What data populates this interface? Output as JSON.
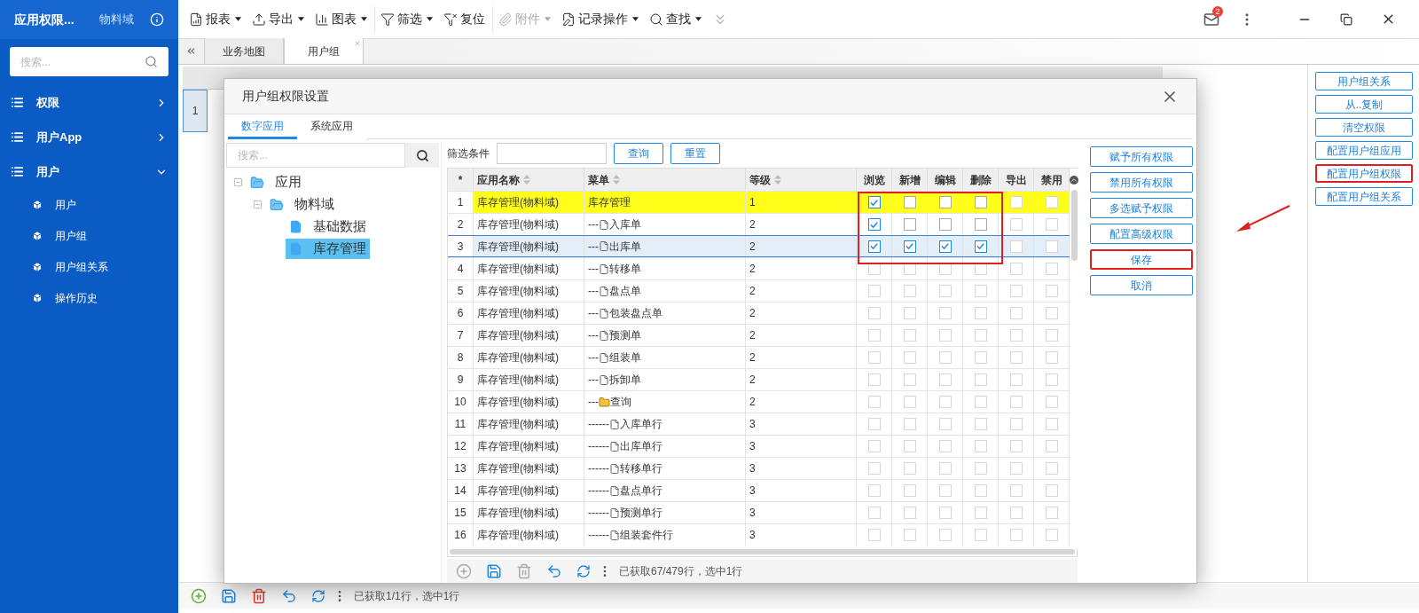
{
  "sidebar": {
    "title": "应用权限...",
    "domain": "物料域",
    "search": {
      "placeholder": "搜索..."
    },
    "items": [
      {
        "label": "权限",
        "expanded": false
      },
      {
        "label": "用户App",
        "expanded": false
      },
      {
        "label": "用户",
        "expanded": true,
        "children": [
          {
            "label": "用户"
          },
          {
            "label": "用户组"
          },
          {
            "label": "用户组关系"
          },
          {
            "label": "操作历史"
          }
        ]
      }
    ]
  },
  "toolbar": [
    {
      "kind": "report",
      "label": "报表",
      "dropdown": true,
      "disabled": false
    },
    {
      "kind": "export",
      "label": "导出",
      "dropdown": true,
      "disabled": false
    },
    {
      "kind": "chart",
      "label": "图表",
      "dropdown": true,
      "disabled": false
    },
    {
      "kind": "filter",
      "label": "筛选",
      "dropdown": true,
      "disabled": false
    },
    {
      "kind": "reset",
      "label": "复位",
      "dropdown": false,
      "disabled": false
    },
    {
      "kind": "attach",
      "label": "附件",
      "dropdown": true,
      "disabled": true
    },
    {
      "kind": "record",
      "label": "记录操作",
      "dropdown": true,
      "disabled": false
    },
    {
      "kind": "find",
      "label": "查找",
      "dropdown": true,
      "disabled": false
    }
  ],
  "mail_badge": "2",
  "tabs": [
    {
      "label": "业务地图",
      "selected": false
    },
    {
      "label": "用户组",
      "selected": true
    }
  ],
  "bg_table": {
    "row_number": "1"
  },
  "bg_status": "已获取1/1行，选中1行",
  "side_buttons": [
    {
      "label": "用户组关系",
      "marked": false
    },
    {
      "label": "从..复制",
      "marked": false
    },
    {
      "label": "清空权限",
      "marked": false
    },
    {
      "label": "配置用户组应用",
      "marked": false
    },
    {
      "label": "配置用户组权限",
      "marked": true
    },
    {
      "label": "配置用户组关系",
      "marked": false
    }
  ],
  "dialog": {
    "title": "用户组权限设置",
    "tabs": [
      {
        "label": "数字应用",
        "selected": true
      },
      {
        "label": "系统应用",
        "selected": false
      }
    ],
    "tree_search": {
      "placeholder": "搜索..."
    },
    "tree": [
      {
        "label": "应用",
        "expanded": true,
        "selected": false,
        "children": [
          {
            "label": "物料域",
            "expanded": true,
            "selected": false,
            "children": [
              {
                "label": "基础数据",
                "selected": false
              },
              {
                "label": "库存管理",
                "selected": true
              }
            ]
          }
        ]
      }
    ],
    "filter_label": "筛选条件",
    "query_button": "查询",
    "reset_button": "重置",
    "columns": [
      "*",
      "应用名称",
      "菜单",
      "等级",
      "浏览",
      "新增",
      "编辑",
      "删除",
      "导出",
      "禁用"
    ],
    "rows": [
      {
        "no": "1",
        "app": "库存管理(物料域)",
        "prefix": "",
        "kind": "root",
        "menu": "库存管理",
        "level": "1",
        "highlighted": true,
        "selected": false,
        "perms": [
          true,
          false,
          false,
          false,
          false,
          false
        ]
      },
      {
        "no": "2",
        "app": "库存管理(物料域)",
        "prefix": "---",
        "kind": "item",
        "menu": "入库单",
        "level": "2",
        "highlighted": false,
        "selected": false,
        "perms": [
          true,
          false,
          false,
          false,
          false,
          false
        ]
      },
      {
        "no": "3",
        "app": "库存管理(物料域)",
        "prefix": "---",
        "kind": "item",
        "menu": "出库单",
        "level": "2",
        "highlighted": false,
        "selected": true,
        "perms": [
          true,
          true,
          true,
          true,
          false,
          false
        ]
      },
      {
        "no": "4",
        "app": "库存管理(物料域)",
        "prefix": "---",
        "kind": "item",
        "menu": "转移单",
        "level": "2",
        "highlighted": false,
        "selected": false,
        "perms": [
          false,
          false,
          false,
          false,
          false,
          false
        ]
      },
      {
        "no": "5",
        "app": "库存管理(物料域)",
        "prefix": "---",
        "kind": "item",
        "menu": "盘点单",
        "level": "2",
        "highlighted": false,
        "selected": false,
        "perms": [
          false,
          false,
          false,
          false,
          false,
          false
        ]
      },
      {
        "no": "6",
        "app": "库存管理(物料域)",
        "prefix": "---",
        "kind": "item",
        "menu": "包装盘点单",
        "level": "2",
        "highlighted": false,
        "selected": false,
        "perms": [
          false,
          false,
          false,
          false,
          false,
          false
        ]
      },
      {
        "no": "7",
        "app": "库存管理(物料域)",
        "prefix": "---",
        "kind": "item",
        "menu": "预测单",
        "level": "2",
        "highlighted": false,
        "selected": false,
        "perms": [
          false,
          false,
          false,
          false,
          false,
          false
        ]
      },
      {
        "no": "8",
        "app": "库存管理(物料域)",
        "prefix": "---",
        "kind": "item",
        "menu": "组装单",
        "level": "2",
        "highlighted": false,
        "selected": false,
        "perms": [
          false,
          false,
          false,
          false,
          false,
          false
        ]
      },
      {
        "no": "9",
        "app": "库存管理(物料域)",
        "prefix": "---",
        "kind": "item",
        "menu": "拆卸单",
        "level": "2",
        "highlighted": false,
        "selected": false,
        "perms": [
          false,
          false,
          false,
          false,
          false,
          false
        ]
      },
      {
        "no": "10",
        "app": "库存管理(物料域)",
        "prefix": "---",
        "kind": "group",
        "menu": "查询",
        "level": "2",
        "highlighted": false,
        "selected": false,
        "perms": [
          false,
          false,
          false,
          false,
          false,
          false
        ]
      },
      {
        "no": "11",
        "app": "库存管理(物料域)",
        "prefix": "------",
        "kind": "item",
        "menu": "入库单行",
        "level": "3",
        "highlighted": false,
        "selected": false,
        "perms": [
          false,
          false,
          false,
          false,
          false,
          false
        ]
      },
      {
        "no": "12",
        "app": "库存管理(物料域)",
        "prefix": "------",
        "kind": "item",
        "menu": "出库单行",
        "level": "3",
        "highlighted": false,
        "selected": false,
        "perms": [
          false,
          false,
          false,
          false,
          false,
          false
        ]
      },
      {
        "no": "13",
        "app": "库存管理(物料域)",
        "prefix": "------",
        "kind": "item",
        "menu": "转移单行",
        "level": "3",
        "highlighted": false,
        "selected": false,
        "perms": [
          false,
          false,
          false,
          false,
          false,
          false
        ]
      },
      {
        "no": "14",
        "app": "库存管理(物料域)",
        "prefix": "------",
        "kind": "item",
        "menu": "盘点单行",
        "level": "3",
        "highlighted": false,
        "selected": false,
        "perms": [
          false,
          false,
          false,
          false,
          false,
          false
        ]
      },
      {
        "no": "15",
        "app": "库存管理(物料域)",
        "prefix": "------",
        "kind": "item",
        "menu": "预测单行",
        "level": "3",
        "highlighted": false,
        "selected": false,
        "perms": [
          false,
          false,
          false,
          false,
          false,
          false
        ]
      },
      {
        "no": "16",
        "app": "库存管理(物料域)",
        "prefix": "------",
        "kind": "item",
        "menu": "组装套件行",
        "level": "3",
        "highlighted": false,
        "selected": false,
        "perms": [
          false,
          false,
          false,
          false,
          false,
          false
        ]
      }
    ],
    "buttons": [
      {
        "label": "赋予所有权限",
        "marked": false
      },
      {
        "label": "禁用所有权限",
        "marked": false
      },
      {
        "label": "多选赋予权限",
        "marked": false
      },
      {
        "label": "配置高级权限",
        "marked": false
      },
      {
        "label": "保存",
        "marked": true
      },
      {
        "label": "取消",
        "marked": false
      }
    ],
    "status": "已获取67/479行，选中1行"
  }
}
